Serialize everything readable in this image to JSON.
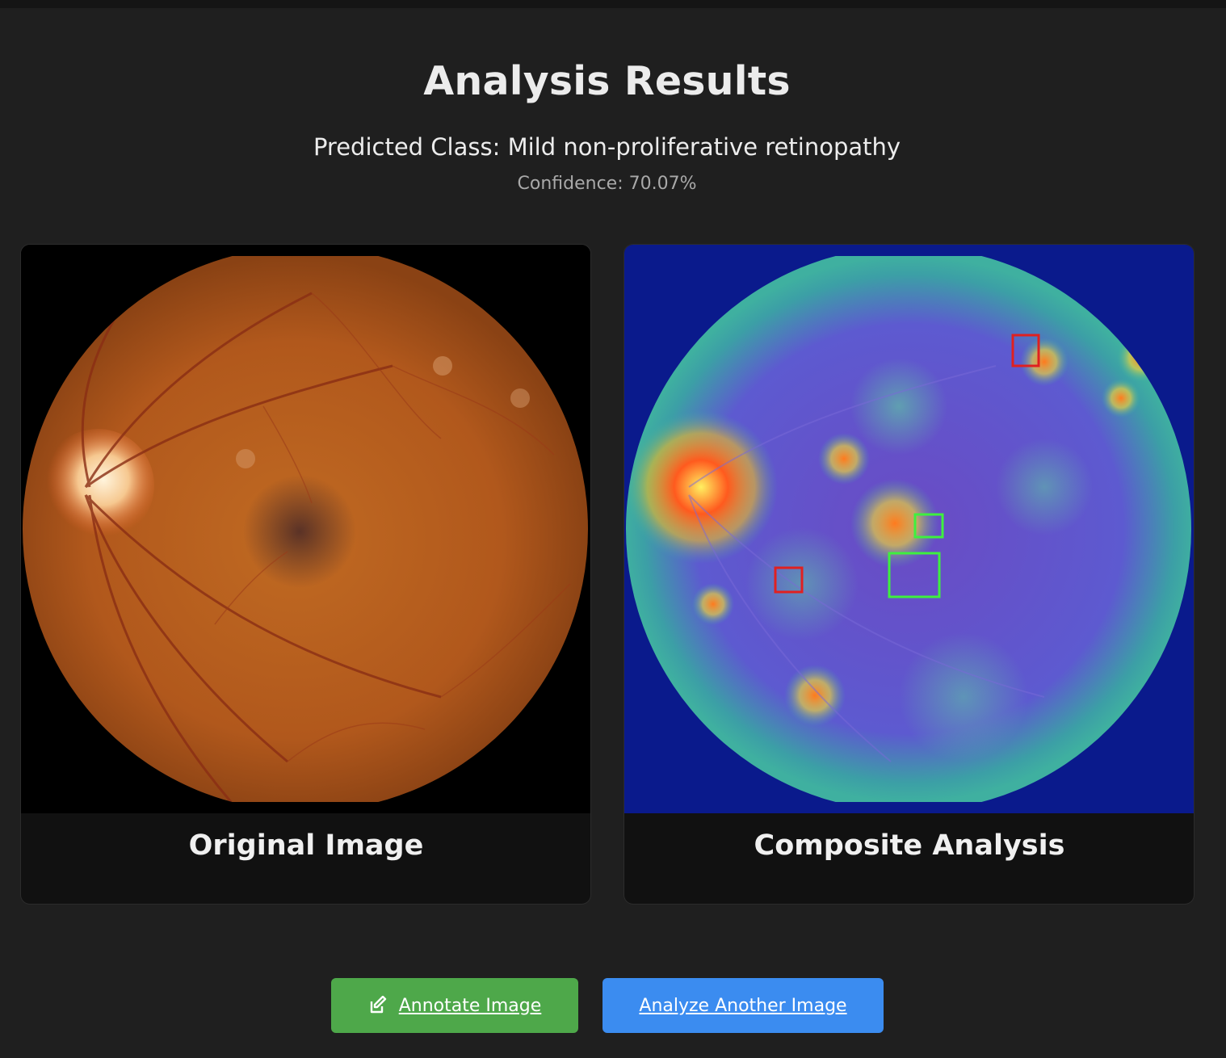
{
  "header": {
    "title": "Analysis Results",
    "predicted_class": "Predicted Class: Mild non-proliferative retinopathy",
    "confidence": "Confidence: 70.07%"
  },
  "panels": [
    {
      "caption": "Original Image",
      "image": "fundus-photograph"
    },
    {
      "caption": "Composite Analysis",
      "image": "heatmap-overlay-with-boxes"
    }
  ],
  "actions": {
    "annotate_label": "Annotate Image",
    "annotate_icon": "edit-icon",
    "analyze_label": "Analyze Another Image"
  },
  "colors": {
    "background": "#1f1f1f",
    "card": "#111111",
    "annotate_button": "#4ea84a",
    "analyze_button": "#3b8cf0",
    "box_red": "#e02020",
    "box_green": "#3ef03e"
  }
}
